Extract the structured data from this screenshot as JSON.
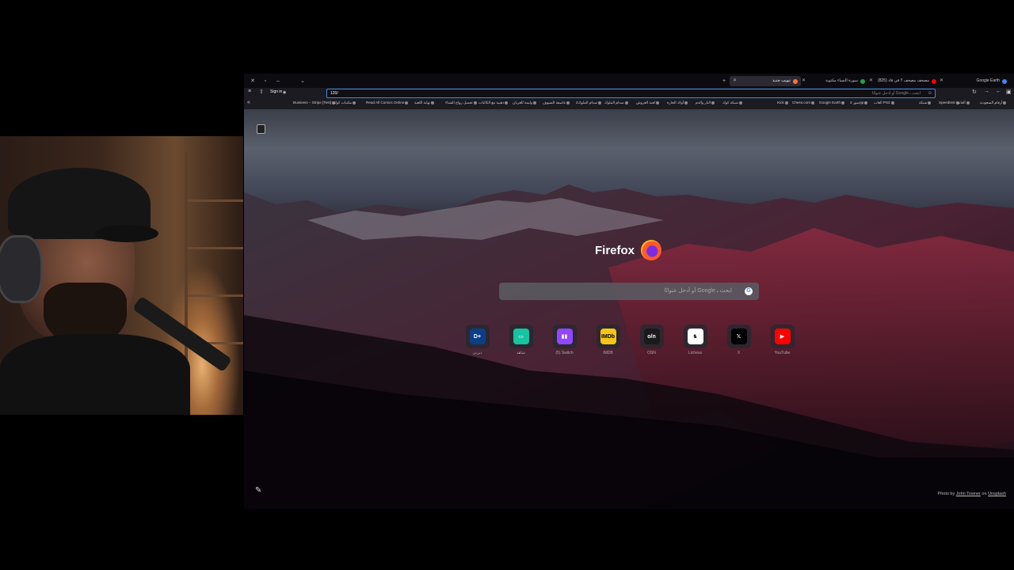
{
  "tabs": [
    {
      "label": "Google Earth",
      "favicon_color": "#4285f4"
    },
    {
      "label": "(825) مصحف مصحف !! في فاد",
      "favicon_color": "#ff0000"
    },
    {
      "label": "سورة النساء مكتوبة",
      "favicon_color": "#1fa24a"
    },
    {
      "label": "تبويب جديد",
      "favicon_color": "#ff7139",
      "active": true
    }
  ],
  "navbar": {
    "sign_in": "Sign in",
    "url_typed": "120/",
    "url_placeholder": "ابحث ب‍ Google أو أدخل عنوانًا"
  },
  "bookmarks": [
    "Business – Stripe [Test]",
    "مكتبات كوك",
    "Read All Comics Online",
    "نهاية اللعبة",
    "تحميل رواج الشتاء",
    "ذهبية مع الكائنات",
    "وليمة للغربان",
    "عاصفة السيوف",
    "صدام الملوك2",
    "صدام الملوك",
    "لعبة العروش",
    "أولاد الحارة",
    "النار والدم",
    "شبكة كوك",
    "Kick",
    "Chess.com",
    "Google Earth",
    "صور 2pp",
    "العاب PS2",
    "شبكة",
    "Speedtest",
    "ألعاب",
    "أرقام السعودية"
  ],
  "ntp": {
    "brand": "Firefox",
    "search_placeholder": "ابحث ب‍ Google أو أدخل عنوانًا",
    "tiles": [
      {
        "label": "ديزني",
        "icon": "disney-plus-icon",
        "color": "#0c3f86",
        "glyph": "D+"
      },
      {
        "label": "شاهد",
        "icon": "shahid-icon",
        "color": "#17c3a0",
        "glyph": "▭"
      },
      {
        "label": "(5) Switch",
        "icon": "twitch-icon",
        "color": "#9146ff",
        "glyph": "▮▮"
      },
      {
        "label": "IMDB",
        "icon": "imdb-icon",
        "color": "#f5c518",
        "glyph": "IMDb"
      },
      {
        "label": "OSN",
        "icon": "osn-icon",
        "color": "#1a1a1a",
        "glyph": "o/n"
      },
      {
        "label": "Lichess",
        "icon": "lichess-icon",
        "color": "#ffffff",
        "glyph": "♞"
      },
      {
        "label": "X",
        "icon": "x-icon",
        "color": "#000000",
        "glyph": "𝕏"
      },
      {
        "label": "YouTube",
        "icon": "youtube-icon",
        "color": "#ff0000",
        "glyph": "▶"
      }
    ],
    "photo_credit": {
      "prefix": "Photo by",
      "author": "John Towner",
      "on": "on",
      "site": "Unsplash"
    }
  }
}
